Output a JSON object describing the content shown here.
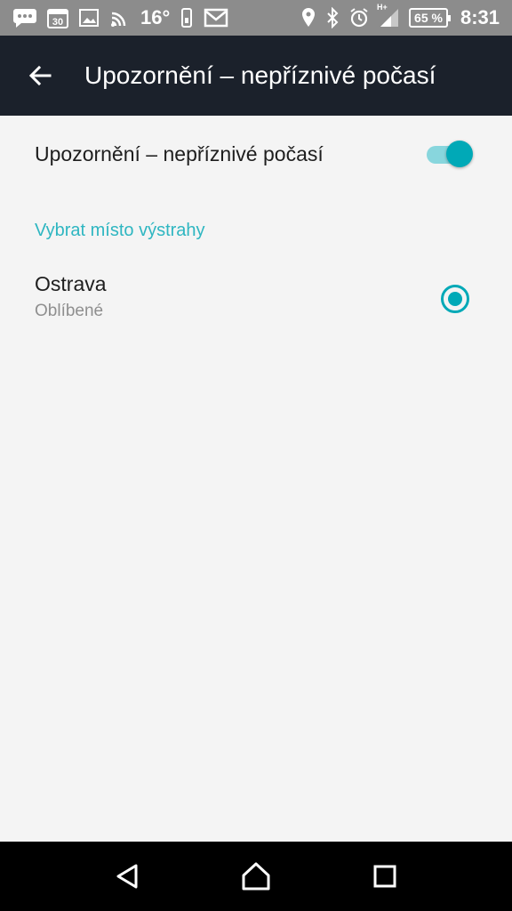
{
  "status_bar": {
    "temperature": "16°",
    "calendar_day": "30",
    "network_type": "H+",
    "battery": "65 %",
    "time": "8:31",
    "icons": [
      "chat-icon",
      "calendar-icon",
      "image-icon",
      "nfc-icon",
      "temperature",
      "phone-icon",
      "mail-icon",
      "location-icon",
      "bluetooth-icon",
      "alarm-icon",
      "signal-icon",
      "battery-icon"
    ]
  },
  "app_bar": {
    "title": "Upozornění – nepříznivé počasí",
    "back_icon": "arrow-back-icon"
  },
  "settings": {
    "toggle": {
      "label": "Upozornění – nepříznivé počasí",
      "enabled": true
    },
    "section_header": "Vybrat místo výstrahy",
    "locations": [
      {
        "name": "Ostrava",
        "subtitle": "Oblíbené",
        "selected": true
      }
    ]
  },
  "nav_bar": {
    "buttons": [
      "back-triangle-icon",
      "home-icon",
      "recents-icon"
    ]
  },
  "colors": {
    "status_bar": "#8c8c8c",
    "app_bar": "#1b212b",
    "background": "#f4f4f4",
    "accent": "#00a9b7",
    "accent_text": "#2eb6c1",
    "switch_track": "#88d6dd",
    "secondary_text": "#8f8f8f",
    "nav_bar": "#000000"
  }
}
